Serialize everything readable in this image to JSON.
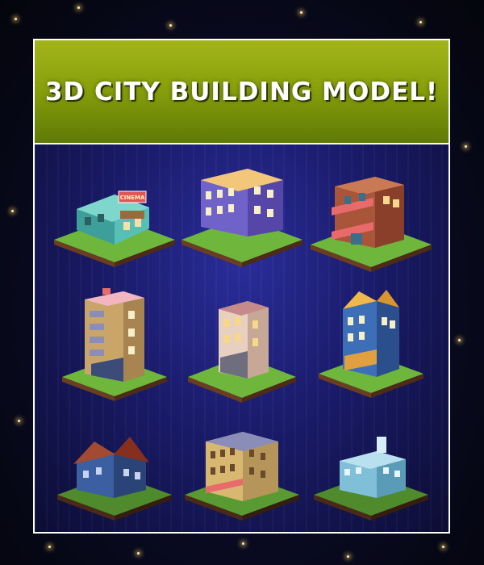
{
  "banner": {
    "title": "3D CITY BUILDING MODEL!"
  },
  "colors": {
    "banner_top": "#a2b41a",
    "banner_bottom": "#5f7a05",
    "gallery_bg": "#1a1b6a",
    "frame_border": "#ffffff",
    "grass": "#7cc242",
    "soil": "#6b3d22"
  },
  "buildings": [
    {
      "name": "cinema",
      "sign": "CINEMA"
    },
    {
      "name": "purple-apartment"
    },
    {
      "name": "brick-shop"
    },
    {
      "name": "tall-tower"
    },
    {
      "name": "small-townhouse"
    },
    {
      "name": "blue-gable-house"
    },
    {
      "name": "victorian-house"
    },
    {
      "name": "corner-hotel"
    },
    {
      "name": "hospital"
    }
  ]
}
